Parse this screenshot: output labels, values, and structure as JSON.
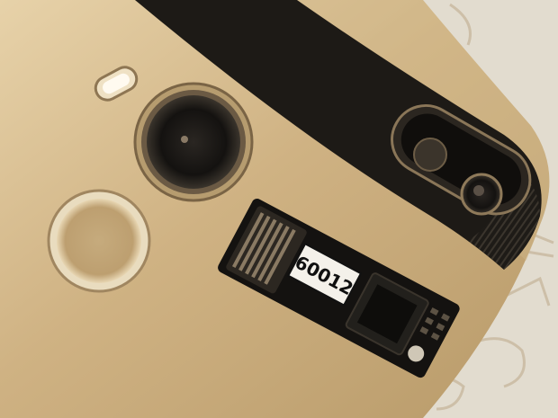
{
  "photo": {
    "module_label": "60012"
  },
  "palette": {
    "paper": "#e2dccf",
    "paper_ink": "#cfc4b1",
    "phone_metal": "#c8a977",
    "phone_shadow": "#a88b5e",
    "phone_highlight": "#e6d1a8",
    "camera_bar": "#1d1a16",
    "board": "#141210",
    "connector": "#3a342c",
    "label_bg": "#f4f1ea",
    "label_text": "#101010"
  }
}
